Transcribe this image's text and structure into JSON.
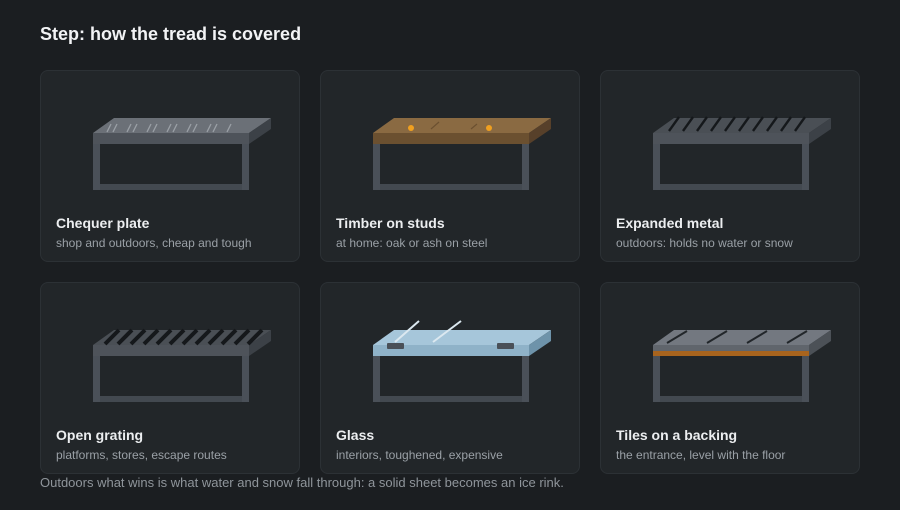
{
  "title": "Step: how the tread is covered",
  "cards": [
    {
      "title": "Chequer plate",
      "subtitle": "shop and outdoors, cheap and tough",
      "icon": "chequer-plate-tread-icon"
    },
    {
      "title": "Timber on studs",
      "subtitle": "at home: oak or ash on steel",
      "icon": "timber-tread-icon"
    },
    {
      "title": "Expanded metal",
      "subtitle": "outdoors: holds no water or snow",
      "icon": "expanded-metal-tread-icon"
    },
    {
      "title": "Open grating",
      "subtitle": "platforms, stores, escape routes",
      "icon": "open-grating-tread-icon"
    },
    {
      "title": "Glass",
      "subtitle": "interiors, toughened, expensive",
      "icon": "glass-tread-icon"
    },
    {
      "title": "Tiles on a backing",
      "subtitle": "the entrance, level with the floor",
      "icon": "tile-tread-icon"
    }
  ],
  "footer": "Outdoors what wins is what water and snow fall through: a solid sheet becomes an ice rink.",
  "colors": {
    "background": "#1b1e21",
    "card": "#222629",
    "frame": "#4a5058",
    "steel_top": "#5a5f66",
    "timber": "#8a6a42",
    "glass": "#9cc0d6",
    "tile_backing": "#a8641e",
    "stud": "#f0a020"
  }
}
